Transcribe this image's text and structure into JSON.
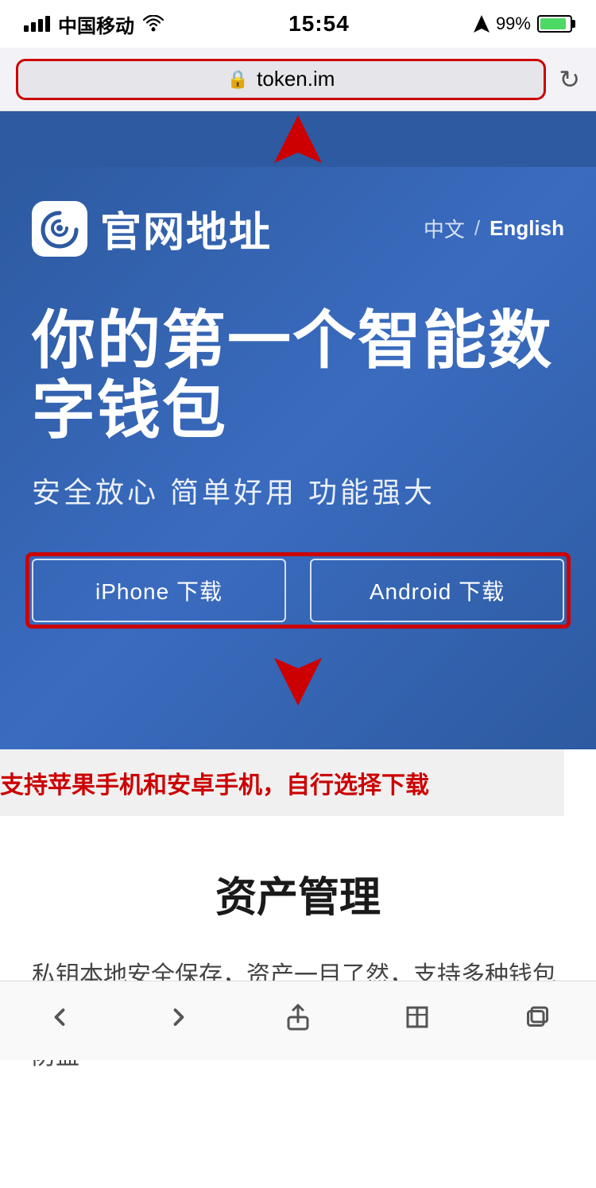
{
  "statusBar": {
    "carrier": "中国移动",
    "time": "15:54",
    "battery": "99%",
    "signal": "full"
  },
  "browserBar": {
    "url": "token.im",
    "lockIcon": "🔒",
    "reloadIcon": "↻"
  },
  "hero": {
    "logoText": "e",
    "siteTitle": "官网地址",
    "langChinese": "中文",
    "langDivider": "/",
    "langEnglish": "English",
    "heading": "你的第一个智能数字钱包",
    "subtitle": "安全放心  简单好用  功能强大",
    "iphoneBtn": "iPhone 下载",
    "androidBtn": "Android 下载"
  },
  "supportText": "支持苹果手机和安卓手机，自行选择下载",
  "contentSection": {
    "title": "资产管理",
    "body": "私钥本地安全保存，资产一目了然，支持多种钱包类型，轻松导入导出，助记词备份防丢，多重签名防盗"
  },
  "bottomNav": {
    "backLabel": "back",
    "forwardLabel": "forward",
    "shareLabel": "share",
    "bookmarkLabel": "bookmark",
    "tabsLabel": "tabs"
  }
}
